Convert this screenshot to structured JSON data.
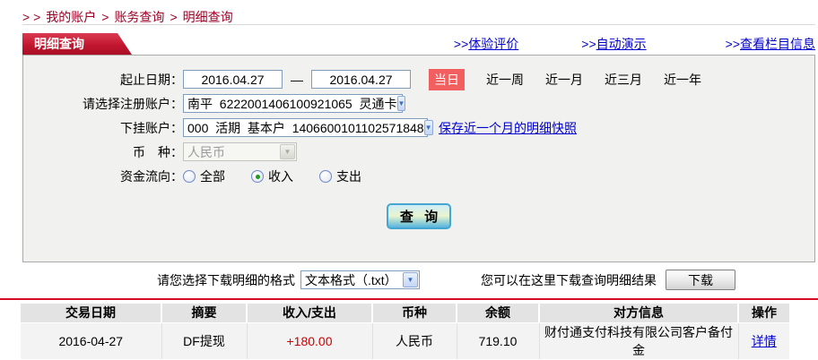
{
  "breadcrumb": {
    "arrows": "> >",
    "separator": ">",
    "items": [
      "我的账户",
      "账务查询",
      "明细查询"
    ]
  },
  "panel": {
    "tab_title": "明细查询",
    "header_links": [
      {
        "prefix": ">>",
        "label": "体验评价"
      },
      {
        "prefix": ">>",
        "label": "自动演示"
      },
      {
        "prefix": ">>",
        "label": "查看栏目信息"
      }
    ],
    "form": {
      "date_range": {
        "label": "起止日期：",
        "start_value": "2016.04.27",
        "separator": "—",
        "end_value": "2016.04.27",
        "today_badge": "当日",
        "quick_links": [
          "近一周",
          "近一月",
          "近三月",
          "近一年"
        ]
      },
      "registered_account": {
        "label": "请选择注册账户：",
        "value": "南平  6222001406100921065  灵通卡"
      },
      "sub_account": {
        "label": "下挂账户：",
        "value": "000  活期  基本户  1406600101102571848",
        "snapshot_link": "保存近一个月的明细快照"
      },
      "currency": {
        "label": "币　种：",
        "value": "人民币"
      },
      "fund_flow": {
        "label": "资金流向：",
        "options": [
          {
            "label": "全部",
            "checked": false
          },
          {
            "label": "收入",
            "checked": true
          },
          {
            "label": "支出",
            "checked": false
          }
        ]
      },
      "query_button": "查 询"
    }
  },
  "download": {
    "format_label": "请您选择下载明细的格式",
    "format_value": "文本格式（.txt）",
    "hint": "您可以在这里下载查询明细结果",
    "button_label": "下载"
  },
  "table": {
    "headers": [
      "交易日期",
      "摘要",
      "收入/支出",
      "币种",
      "余额",
      "对方信息",
      "操作"
    ],
    "rows": [
      {
        "date": "2016-04-27",
        "summary": "DF提现",
        "amount": "+180.00",
        "currency": "人民币",
        "balance": "719.10",
        "counterparty": "财付通支付科技有限公司客户备付金",
        "action": "详情"
      }
    ]
  },
  "icons": {
    "select_arrow": "▼"
  },
  "colors": {
    "breadcrumb_red": "#9c0026",
    "tab_red": "#c3162f",
    "link_blue": "#0000cc",
    "today_badge_red": "#f25f5f",
    "amount_red": "#cc0000",
    "table_line_red": "#d60b28",
    "radio_checked_green": "#18a018"
  }
}
